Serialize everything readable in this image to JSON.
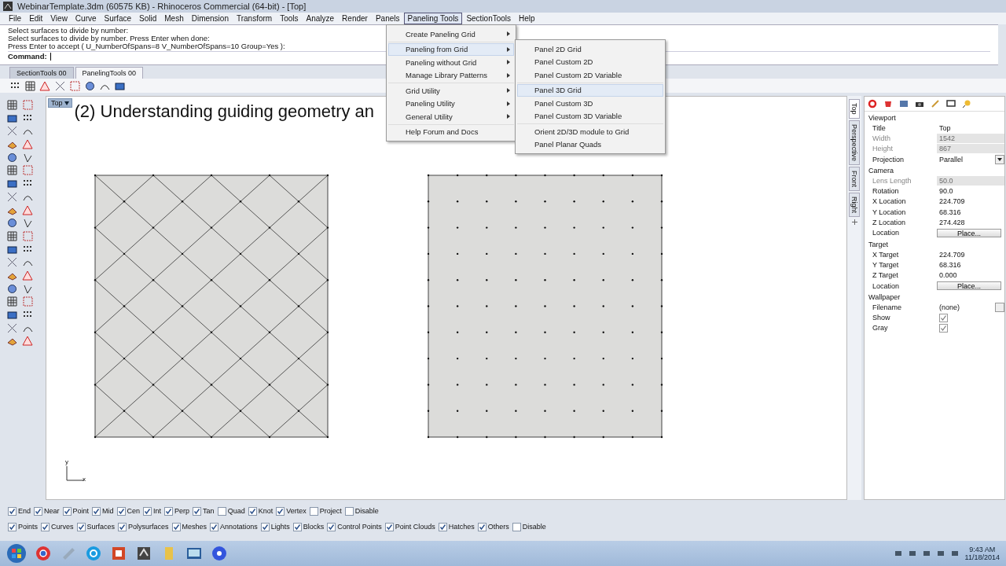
{
  "window": {
    "title": "WebinarTemplate.3dm (60575 KB) - Rhinoceros Commercial (64-bit) - [Top]"
  },
  "menu_bar": [
    {
      "label": "File",
      "selected": false
    },
    {
      "label": "Edit",
      "selected": false
    },
    {
      "label": "View",
      "selected": false
    },
    {
      "label": "Curve",
      "selected": false
    },
    {
      "label": "Surface",
      "selected": false
    },
    {
      "label": "Solid",
      "selected": false
    },
    {
      "label": "Mesh",
      "selected": false
    },
    {
      "label": "Dimension",
      "selected": false
    },
    {
      "label": "Transform",
      "selected": false
    },
    {
      "label": "Tools",
      "selected": false
    },
    {
      "label": "Analyze",
      "selected": false
    },
    {
      "label": "Render",
      "selected": false
    },
    {
      "label": "Panels",
      "selected": false
    },
    {
      "label": "Paneling Tools",
      "selected": true
    },
    {
      "label": "SectionTools",
      "selected": false
    },
    {
      "label": "Help",
      "selected": false
    }
  ],
  "command_history": [
    "Select surfaces to divide by number:",
    "Select surfaces to divide by number. Press Enter when done:",
    "Press Enter to accept ( U_NumberOfSpans=8  V_NumberOfSpans=10  Group=Yes ):"
  ],
  "command": {
    "label": "Command:"
  },
  "toolbar_tabs": [
    {
      "label": "SectionTools 00",
      "selected": false
    },
    {
      "label": "PanelingTools 00",
      "selected": true
    }
  ],
  "viewport": {
    "label": "Top",
    "title": "(2) Understanding guiding geometry an",
    "axis_labels": [
      "y",
      "x"
    ]
  },
  "menu": {
    "groups": [
      [
        {
          "label": "Create Paneling Grid",
          "selected": false,
          "submenu": true
        }
      ],
      [
        {
          "label": "Paneling from Grid",
          "selected": true,
          "submenu": true
        },
        {
          "label": "Paneling without Grid",
          "selected": false,
          "submenu": true
        },
        {
          "label": "Manage Library Patterns",
          "selected": false,
          "submenu": true
        }
      ],
      [
        {
          "label": "Grid Utility",
          "selected": false,
          "submenu": true
        },
        {
          "label": "Paneling Utility",
          "selected": false,
          "submenu": true
        },
        {
          "label": "General Utility",
          "selected": false,
          "submenu": true
        }
      ],
      [
        {
          "label": "Help Forum and Docs",
          "selected": false,
          "submenu": false
        }
      ]
    ]
  },
  "submenu": {
    "groups": [
      [
        {
          "label": "Panel 2D Grid",
          "selected": false
        },
        {
          "label": "Panel Custom 2D",
          "selected": false
        },
        {
          "label": "Panel Custom 2D Variable",
          "selected": false
        }
      ],
      [
        {
          "label": "Panel 3D Grid",
          "selected": true
        },
        {
          "label": "Panel Custom 3D",
          "selected": false
        },
        {
          "label": "Panel Custom 3D Variable",
          "selected": false
        }
      ],
      [
        {
          "label": "Orient 2D/3D module to Grid",
          "selected": false
        },
        {
          "label": "Panel Planar Quads",
          "selected": false
        }
      ]
    ]
  },
  "view_tabs": [
    {
      "label": "Top",
      "selected": true
    },
    {
      "label": "Perspective",
      "selected": false
    },
    {
      "label": "Front",
      "selected": false
    },
    {
      "label": "Right",
      "selected": false
    }
  ],
  "properties": {
    "sections": [
      {
        "title": "Viewport",
        "rows": [
          {
            "kind": "text",
            "label": "Title",
            "value": "Top"
          },
          {
            "kind": "disabled",
            "label": "Width",
            "value": "1542"
          },
          {
            "kind": "disabled",
            "label": "Height",
            "value": "867"
          },
          {
            "kind": "dropdown",
            "label": "Projection",
            "value": "Parallel"
          }
        ]
      },
      {
        "title": "Camera",
        "rows": [
          {
            "kind": "disabled",
            "label": "Lens Length",
            "value": "50.0"
          },
          {
            "kind": "text",
            "label": "Rotation",
            "value": "90.0"
          },
          {
            "kind": "text",
            "label": "X Location",
            "value": "224.709"
          },
          {
            "kind": "text",
            "label": "Y Location",
            "value": "68.316"
          },
          {
            "kind": "text",
            "label": "Z Location",
            "value": "274.428"
          },
          {
            "kind": "button",
            "label": "Location",
            "value": "Place..."
          }
        ]
      },
      {
        "title": "Target",
        "rows": [
          {
            "kind": "text",
            "label": "X Target",
            "value": "224.709"
          },
          {
            "kind": "text",
            "label": "Y Target",
            "value": "68.316"
          },
          {
            "kind": "text",
            "label": "Z Target",
            "value": "0.000"
          },
          {
            "kind": "button",
            "label": "Location",
            "value": "Place..."
          }
        ]
      },
      {
        "title": "Wallpaper",
        "rows": [
          {
            "kind": "file",
            "label": "Filename",
            "value": "(none)"
          },
          {
            "kind": "checkbox",
            "label": "Show",
            "checked": true
          },
          {
            "kind": "checkbox",
            "label": "Gray",
            "checked": true
          }
        ]
      }
    ]
  },
  "osnaps": [
    {
      "label": "End",
      "checked": true
    },
    {
      "label": "Near",
      "checked": true
    },
    {
      "label": "Point",
      "checked": true
    },
    {
      "label": "Mid",
      "checked": true
    },
    {
      "label": "Cen",
      "checked": true
    },
    {
      "label": "Int",
      "checked": true
    },
    {
      "label": "Perp",
      "checked": true
    },
    {
      "label": "Tan",
      "checked": true
    },
    {
      "label": "Quad",
      "checked": false
    },
    {
      "label": "Knot",
      "checked": true
    },
    {
      "label": "Vertex",
      "checked": true
    },
    {
      "label": "Project",
      "checked": false
    },
    {
      "label": "Disable",
      "checked": false
    }
  ],
  "filters": [
    {
      "label": "Points",
      "checked": true
    },
    {
      "label": "Curves",
      "checked": true
    },
    {
      "label": "Surfaces",
      "checked": true
    },
    {
      "label": "Polysurfaces",
      "checked": true
    },
    {
      "label": "Meshes",
      "checked": true
    },
    {
      "label": "Annotations",
      "checked": true
    },
    {
      "label": "Lights",
      "checked": true
    },
    {
      "label": "Blocks",
      "checked": true
    },
    {
      "label": "Control Points",
      "checked": true
    },
    {
      "label": "Point Clouds",
      "checked": true
    },
    {
      "label": "Hatches",
      "checked": true
    },
    {
      "label": "Others",
      "checked": true
    },
    {
      "label": "Disable",
      "checked": false
    }
  ],
  "taskbar": {
    "time": "9:43 AM",
    "date": "11/18/2014"
  }
}
